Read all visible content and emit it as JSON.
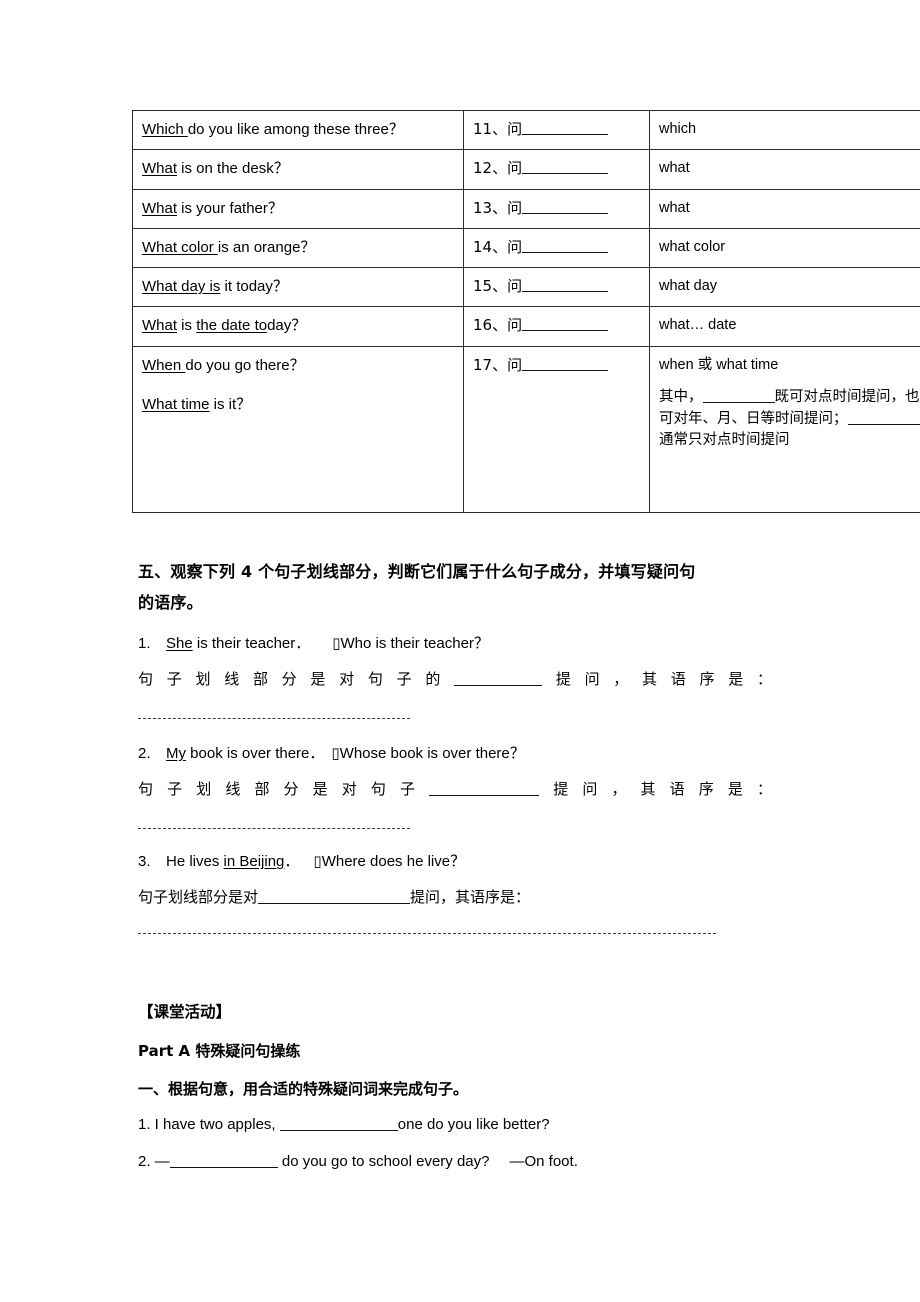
{
  "table": {
    "rows": [
      {
        "english": [
          "<u>Which </u>do you like among these three？"
        ],
        "number": "11、问",
        "answer_lines": [
          "which"
        ]
      },
      {
        "english": [
          "<u>What</u> is on the desk？"
        ],
        "number": "12、问",
        "answer_lines": [
          "what"
        ]
      },
      {
        "english": [
          "<u>What</u> is your father？"
        ],
        "number": "13、问",
        "answer_lines": [
          "what"
        ]
      },
      {
        "english": [
          "<u>What color </u>is an orange？"
        ],
        "number": "14、问",
        "answer_lines": [
          "what color"
        ]
      },
      {
        "english": [
          "<u>What day is</u> it today？"
        ],
        "number": "15、问",
        "answer_lines": [
          "what day"
        ]
      },
      {
        "english": [
          "<u>What</u> is <u>the date to</u>day？"
        ],
        "number": "16、问",
        "answer_lines": [
          "what…  date"
        ]
      },
      {
        "english": [
          "<u>When </u>do you go there？",
          "<u>What time</u> is it？"
        ],
        "number": "17、问",
        "answer_lines": [
          "when 或 what   time",
          "其中，________既可对点时间提问，也可对年、月、日等时间提问；________通常只对点时间提问"
        ]
      }
    ]
  },
  "section_five": {
    "heading_line1": "五、观察下列 4 个句子划线部分，判断它们属于什么句子成分，并填写疑问句",
    "heading_line2": "的语序。",
    "items": [
      {
        "number": "1.",
        "sentence_pre": "She",
        "sentence_post": " is their teacher．",
        "arrow": "▯",
        "question": "Who is their teacher？",
        "prompt_pre": "句子划线部分是对句子的",
        "prompt_post": "提问，其语序是："
      },
      {
        "number": "2.",
        "sentence_pre": "My",
        "sentence_post": " book is over there．",
        "arrow": "▯",
        "question": "Whose book is over there？",
        "prompt_pre": "句子划线部分是对句子",
        "prompt_post": "提问，其语序是："
      },
      {
        "number": "3.",
        "sentence_pre_plain": "He lives ",
        "sentence_underlined": "in Beijing",
        "sentence_post": "．",
        "arrow": "▯",
        "question": "Where does he live？",
        "prompt_pre": "句子划线部分是对",
        "prompt_post": "提问，其语序是："
      }
    ]
  },
  "activity": {
    "heading": "【课堂活动】",
    "part_label": "Part A 特殊疑问句操练",
    "exercise_heading": "一、根据句意，用合适的特殊疑问词来完成句子。",
    "questions": [
      {
        "pre": "1. I have two apples, ",
        "post": "one do you like better?"
      },
      {
        "pre": "2. —",
        "mid": " do you go to school every day?",
        "post": "—On foot."
      }
    ]
  }
}
